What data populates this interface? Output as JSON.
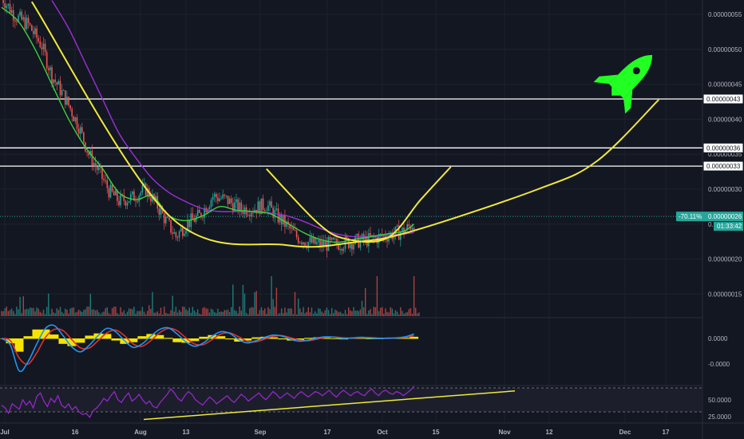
{
  "colors": {
    "background": "#131722",
    "grid": "#1e222d",
    "up_candle": "#26a69a",
    "down_candle": "#ef5350",
    "ma_fast": "#3cd13c",
    "ma_slow": "#9b30d6",
    "annotation": "#f0e83c",
    "rocket": "#22ff22",
    "macd_line": "#2196f3",
    "macd_signal": "#e0312f",
    "macd_hist": "#f5e400",
    "rsi_line": "#9c27d4",
    "price_badge": "#26a69a",
    "level_line": "#ffffff"
  },
  "icons": {
    "rocket": "rocket-icon"
  },
  "chart_data": [
    {
      "type": "candlestick",
      "name": "",
      "x_ticks": [
        "Jul",
        "16",
        "Aug",
        "13",
        "Sep",
        "17",
        "Oct",
        "15",
        "Nov",
        "12",
        "Dec",
        "17"
      ],
      "y_ticks": [
        "0.00000055",
        "0.00000050",
        "0.00000045",
        "0.00000040",
        "0.00000035",
        "0.00000030",
        "0.00000025",
        "0.00000020",
        "0.00000015"
      ],
      "ylim": [
        1.1e-07,
        5.7e-07
      ],
      "levels": [
        {
          "label": "0.00000043",
          "value": 4.29e-07
        },
        {
          "label": "0.00000036",
          "value": 3.59e-07
        },
        {
          "label": "0.00000033",
          "value": 3.33e-07
        }
      ],
      "last_price": {
        "change_label": "-70.11%",
        "price_label": "0.00000026",
        "countdown": "01:33:42",
        "value": 2.61e-07
      },
      "price_path": [
        [
          0,
          5.75e-07
        ],
        [
          8,
          5.48e-07
        ],
        [
          16,
          5.35e-07
        ],
        [
          24,
          5.05e-07
        ],
        [
          30,
          4.62e-07
        ],
        [
          38,
          4.3e-07
        ],
        [
          46,
          3.9e-07
        ],
        [
          52,
          3.5e-07
        ],
        [
          58,
          3.25e-07
        ],
        [
          64,
          2.98e-07
        ],
        [
          70,
          2.83e-07
        ],
        [
          78,
          2.88e-07
        ],
        [
          86,
          3e-07
        ],
        [
          92,
          2.8e-07
        ],
        [
          98,
          2.55e-07
        ],
        [
          104,
          2.32e-07
        ],
        [
          110,
          2.5e-07
        ],
        [
          118,
          2.62e-07
        ],
        [
          126,
          2.9e-07
        ],
        [
          134,
          2.85e-07
        ],
        [
          142,
          2.72e-07
        ],
        [
          150,
          2.72e-07
        ],
        [
          158,
          2.78e-07
        ],
        [
          164,
          2.62e-07
        ],
        [
          170,
          2.48e-07
        ],
        [
          176,
          2.32e-07
        ],
        [
          182,
          2.25e-07
        ],
        [
          190,
          2.2e-07
        ],
        [
          200,
          2.22e-07
        ],
        [
          210,
          2.25e-07
        ],
        [
          220,
          2.28e-07
        ],
        [
          230,
          2.34e-07
        ],
        [
          240,
          2.4e-07
        ],
        [
          246,
          2.52e-07
        ]
      ],
      "ma_fast": [
        [
          0,
          5.6e-07
        ],
        [
          10,
          5.4e-07
        ],
        [
          20,
          5e-07
        ],
        [
          30,
          4.5e-07
        ],
        [
          40,
          4e-07
        ],
        [
          50,
          3.6e-07
        ],
        [
          60,
          3.3e-07
        ],
        [
          70,
          2.95e-07
        ],
        [
          80,
          2.85e-07
        ],
        [
          90,
          2.9e-07
        ],
        [
          100,
          2.62e-07
        ],
        [
          110,
          2.55e-07
        ],
        [
          120,
          2.62e-07
        ],
        [
          130,
          2.75e-07
        ],
        [
          140,
          2.7e-07
        ],
        [
          150,
          2.68e-07
        ],
        [
          160,
          2.65e-07
        ],
        [
          170,
          2.52e-07
        ],
        [
          180,
          2.38e-07
        ],
        [
          190,
          2.28e-07
        ],
        [
          200,
          2.24e-07
        ],
        [
          210,
          2.28e-07
        ],
        [
          220,
          2.32e-07
        ],
        [
          230,
          2.36e-07
        ],
        [
          240,
          2.4e-07
        ],
        [
          246,
          2.5e-07
        ]
      ],
      "ma_slow": [
        [
          30,
          5.7e-07
        ],
        [
          40,
          5.3e-07
        ],
        [
          50,
          4.8e-07
        ],
        [
          60,
          4.3e-07
        ],
        [
          70,
          3.8e-07
        ],
        [
          80,
          3.45e-07
        ],
        [
          90,
          3.15e-07
        ],
        [
          100,
          2.95e-07
        ],
        [
          110,
          2.82e-07
        ],
        [
          120,
          2.72e-07
        ],
        [
          130,
          2.68e-07
        ],
        [
          140,
          2.68e-07
        ],
        [
          150,
          2.68e-07
        ],
        [
          160,
          2.66e-07
        ],
        [
          170,
          2.62e-07
        ],
        [
          180,
          2.54e-07
        ],
        [
          190,
          2.44e-07
        ],
        [
          200,
          2.36e-07
        ],
        [
          210,
          2.32e-07
        ],
        [
          220,
          2.32e-07
        ],
        [
          230,
          2.34e-07
        ],
        [
          240,
          2.36e-07
        ],
        [
          246,
          2.38e-07
        ]
      ],
      "arc_bottom": [
        [
          18,
          5.68e-07
        ],
        [
          100,
          2.62e-07
        ],
        [
          170,
          2.2e-07
        ],
        [
          210,
          2.24e-07
        ],
        [
          245,
          2.4e-07
        ],
        [
          320,
          3e-07
        ],
        [
          355,
          3.4e-07
        ],
        [
          392,
          4.28e-07
        ]
      ],
      "arc_right": [
        [
          158,
          3.29e-07
        ],
        [
          188,
          2.53e-07
        ],
        [
          205,
          2.29e-07
        ],
        [
          230,
          2.3e-07
        ],
        [
          250,
          2.85e-07
        ],
        [
          268,
          3.32e-07
        ]
      ]
    },
    {
      "type": "bar",
      "name": "",
      "count": 250
    },
    {
      "type": "line",
      "name": "",
      "y_ticks": [
        "0.0000",
        "-0.0000"
      ],
      "series": [
        {
          "values": [
            0.0,
            -1.2,
            -5.8,
            -4.2,
            -1.0,
            1.8,
            2.3,
            0.5,
            -1.5,
            -2.4,
            -1.2,
            0.5,
            1.8,
            1.2,
            -0.4,
            -1.6,
            -1.0,
            0.4,
            1.6,
            1.9,
            0.8,
            -0.6,
            -1.4,
            -0.8,
            0.4,
            1.2,
            0.9,
            -0.2,
            -0.8,
            -0.4,
            0.2,
            0.6,
            0.4,
            -0.2,
            -0.5,
            -0.3,
            0.1,
            0.3,
            0.2,
            0.0,
            0.1,
            0.2,
            0.1,
            0.0,
            0.05,
            0.1,
            0.3,
            0.8
          ]
        },
        {
          "values": [
            0.0,
            -0.4,
            -3.5,
            -4.6,
            -2.6,
            0.2,
            1.6,
            1.4,
            -0.2,
            -1.7,
            -1.7,
            -0.4,
            1.0,
            1.5,
            0.5,
            -1.0,
            -1.4,
            -0.4,
            1.0,
            1.8,
            1.4,
            0.1,
            -1.0,
            -1.1,
            -0.2,
            0.8,
            1.0,
            0.3,
            -0.5,
            -0.6,
            -0.1,
            0.4,
            0.5,
            0.1,
            -0.3,
            -0.4,
            -0.1,
            0.2,
            0.25,
            0.1,
            0.05,
            0.15,
            0.15,
            0.05,
            0.02,
            0.08,
            0.2,
            0.5
          ]
        }
      ],
      "histogram": [
        0.0,
        -0.8,
        -2.3,
        0.4,
        1.6,
        1.6,
        0.7,
        -0.9,
        -1.3,
        -0.7,
        0.5,
        0.9,
        0.8,
        -0.3,
        -0.9,
        -0.6,
        0.4,
        0.8,
        0.6,
        0.1,
        -0.6,
        -0.7,
        -0.4,
        0.3,
        0.6,
        0.4,
        -0.1,
        -0.5,
        -0.3,
        0.2,
        0.3,
        0.2,
        -0.1,
        -0.3,
        -0.2,
        0.1,
        0.2,
        0.1,
        -0.05,
        -0.1,
        0.05,
        0.05,
        -0.05,
        -0.05,
        0.03,
        0.02,
        0.1,
        0.3
      ]
    },
    {
      "type": "line",
      "name": "",
      "y_ticks": [
        "50.0000",
        "25.0000"
      ],
      "ylim": [
        18,
        78
      ],
      "values": [
        42,
        38,
        30,
        44,
        40,
        36,
        50,
        42,
        48,
        38,
        55,
        60,
        48,
        40,
        52,
        46,
        56,
        42,
        38,
        44,
        35,
        40,
        32,
        28,
        30,
        24,
        34,
        38,
        44,
        52,
        48,
        56,
        62,
        50,
        46,
        54,
        60,
        48,
        52,
        58,
        50,
        44,
        48,
        40,
        38,
        46,
        52,
        58,
        66,
        60,
        52,
        48,
        56,
        62,
        58,
        50,
        46,
        42,
        48,
        54,
        50,
        44,
        48,
        52,
        56,
        50,
        46,
        52,
        58,
        54,
        48,
        52,
        56,
        60,
        54,
        50,
        56,
        62,
        58,
        52,
        56,
        60,
        56,
        52,
        58,
        62,
        58,
        54,
        58,
        62,
        60,
        56,
        60,
        64,
        58,
        54,
        60,
        64,
        60,
        56,
        60,
        62,
        58,
        56,
        62,
        66,
        60,
        56,
        62,
        64,
        60,
        58,
        62,
        60,
        56,
        60,
        64,
        70
      ],
      "trendline": [
        [
          180,
          21
        ],
        [
          645,
          63
        ]
      ]
    }
  ]
}
